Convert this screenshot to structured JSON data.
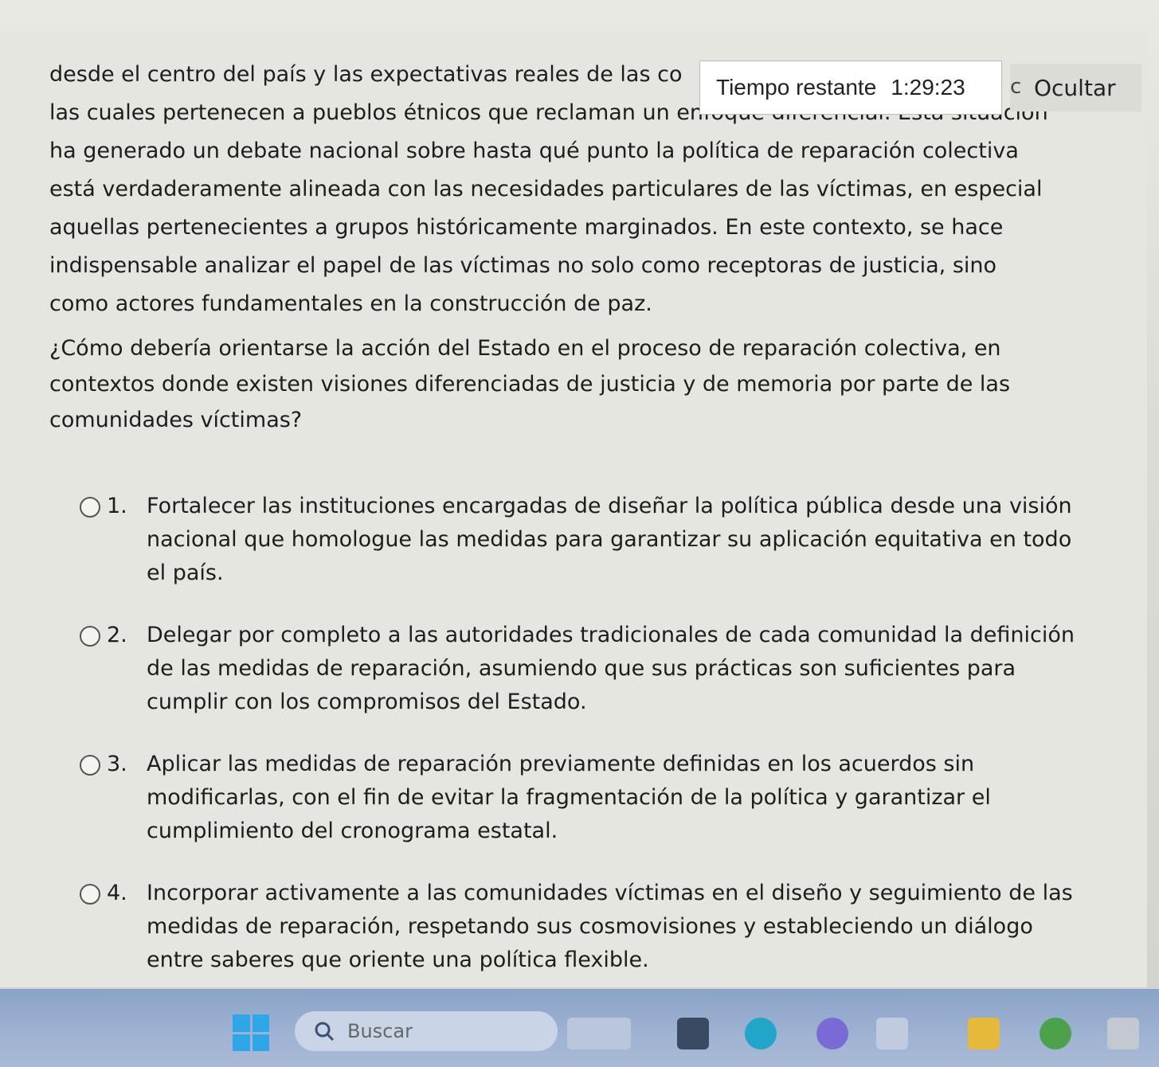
{
  "passage": {
    "lines": [
      "desde el centro del país y las expectativas reales de las co",
      "las cuales pertenecen a pueblos étnicos que reclaman un enfoque diferencial. Esta situación",
      "ha generado un debate nacional sobre hasta qué punto la política de reparación colectiva",
      "está verdaderamente alineada con las necesidades particulares de las víctimas, en especial",
      "aquellas pertenecientes a grupos históricamente marginados. En este contexto, se hace",
      "indispensable analizar el papel de las víctimas no solo como receptoras de justicia, sino",
      "como actores fundamentales en la construcción de paz."
    ]
  },
  "question": "¿Cómo debería orientarse la acción del Estado en el proceso de reparación colectiva, en contextos donde existen visiones diferenciadas de justicia y de memoria por parte de las comunidades víctimas?",
  "options": [
    {
      "number": "1.",
      "text": "Fortalecer las instituciones encargadas de diseñar la política pública desde una visión nacional que homologue las medidas para garantizar su aplicación equitativa en todo el país."
    },
    {
      "number": "2.",
      "text": "Delegar por completo a las autoridades tradicionales de cada comunidad la definición de las medidas de reparación, asumiendo que sus prácticas son suficientes para cumplir con los compromisos del Estado."
    },
    {
      "number": "3.",
      "text": "Aplicar las medidas de reparación previamente definidas en los acuerdos sin modificarlas, con el fin de evitar la fragmentación de la política y garantizar el cumplimiento del cronograma estatal."
    },
    {
      "number": "4.",
      "text": "Incorporar activamente a las comunidades víctimas en el diseño y seguimiento de las medidas de reparación, respetando sus cosmovisiones y estableciendo un diálogo entre saberes que oriente una política flexible."
    }
  ],
  "timer": {
    "label": "Tiempo restante",
    "value": "1:29:23"
  },
  "hide_button": {
    "partial": "c",
    "label": "Ocultar"
  },
  "taskbar": {
    "search_placeholder": "Buscar",
    "icons": [
      "windows-start-icon",
      "search-icon",
      "widgets-icon",
      "task-view-icon",
      "edge-icon",
      "app-icon",
      "file-explorer-icon",
      "chrome-icon"
    ]
  },
  "colors": {
    "page_bg": "#e6e6e1",
    "taskbar": "#9fb3d3",
    "windows_blue": "#2fa6e8"
  }
}
